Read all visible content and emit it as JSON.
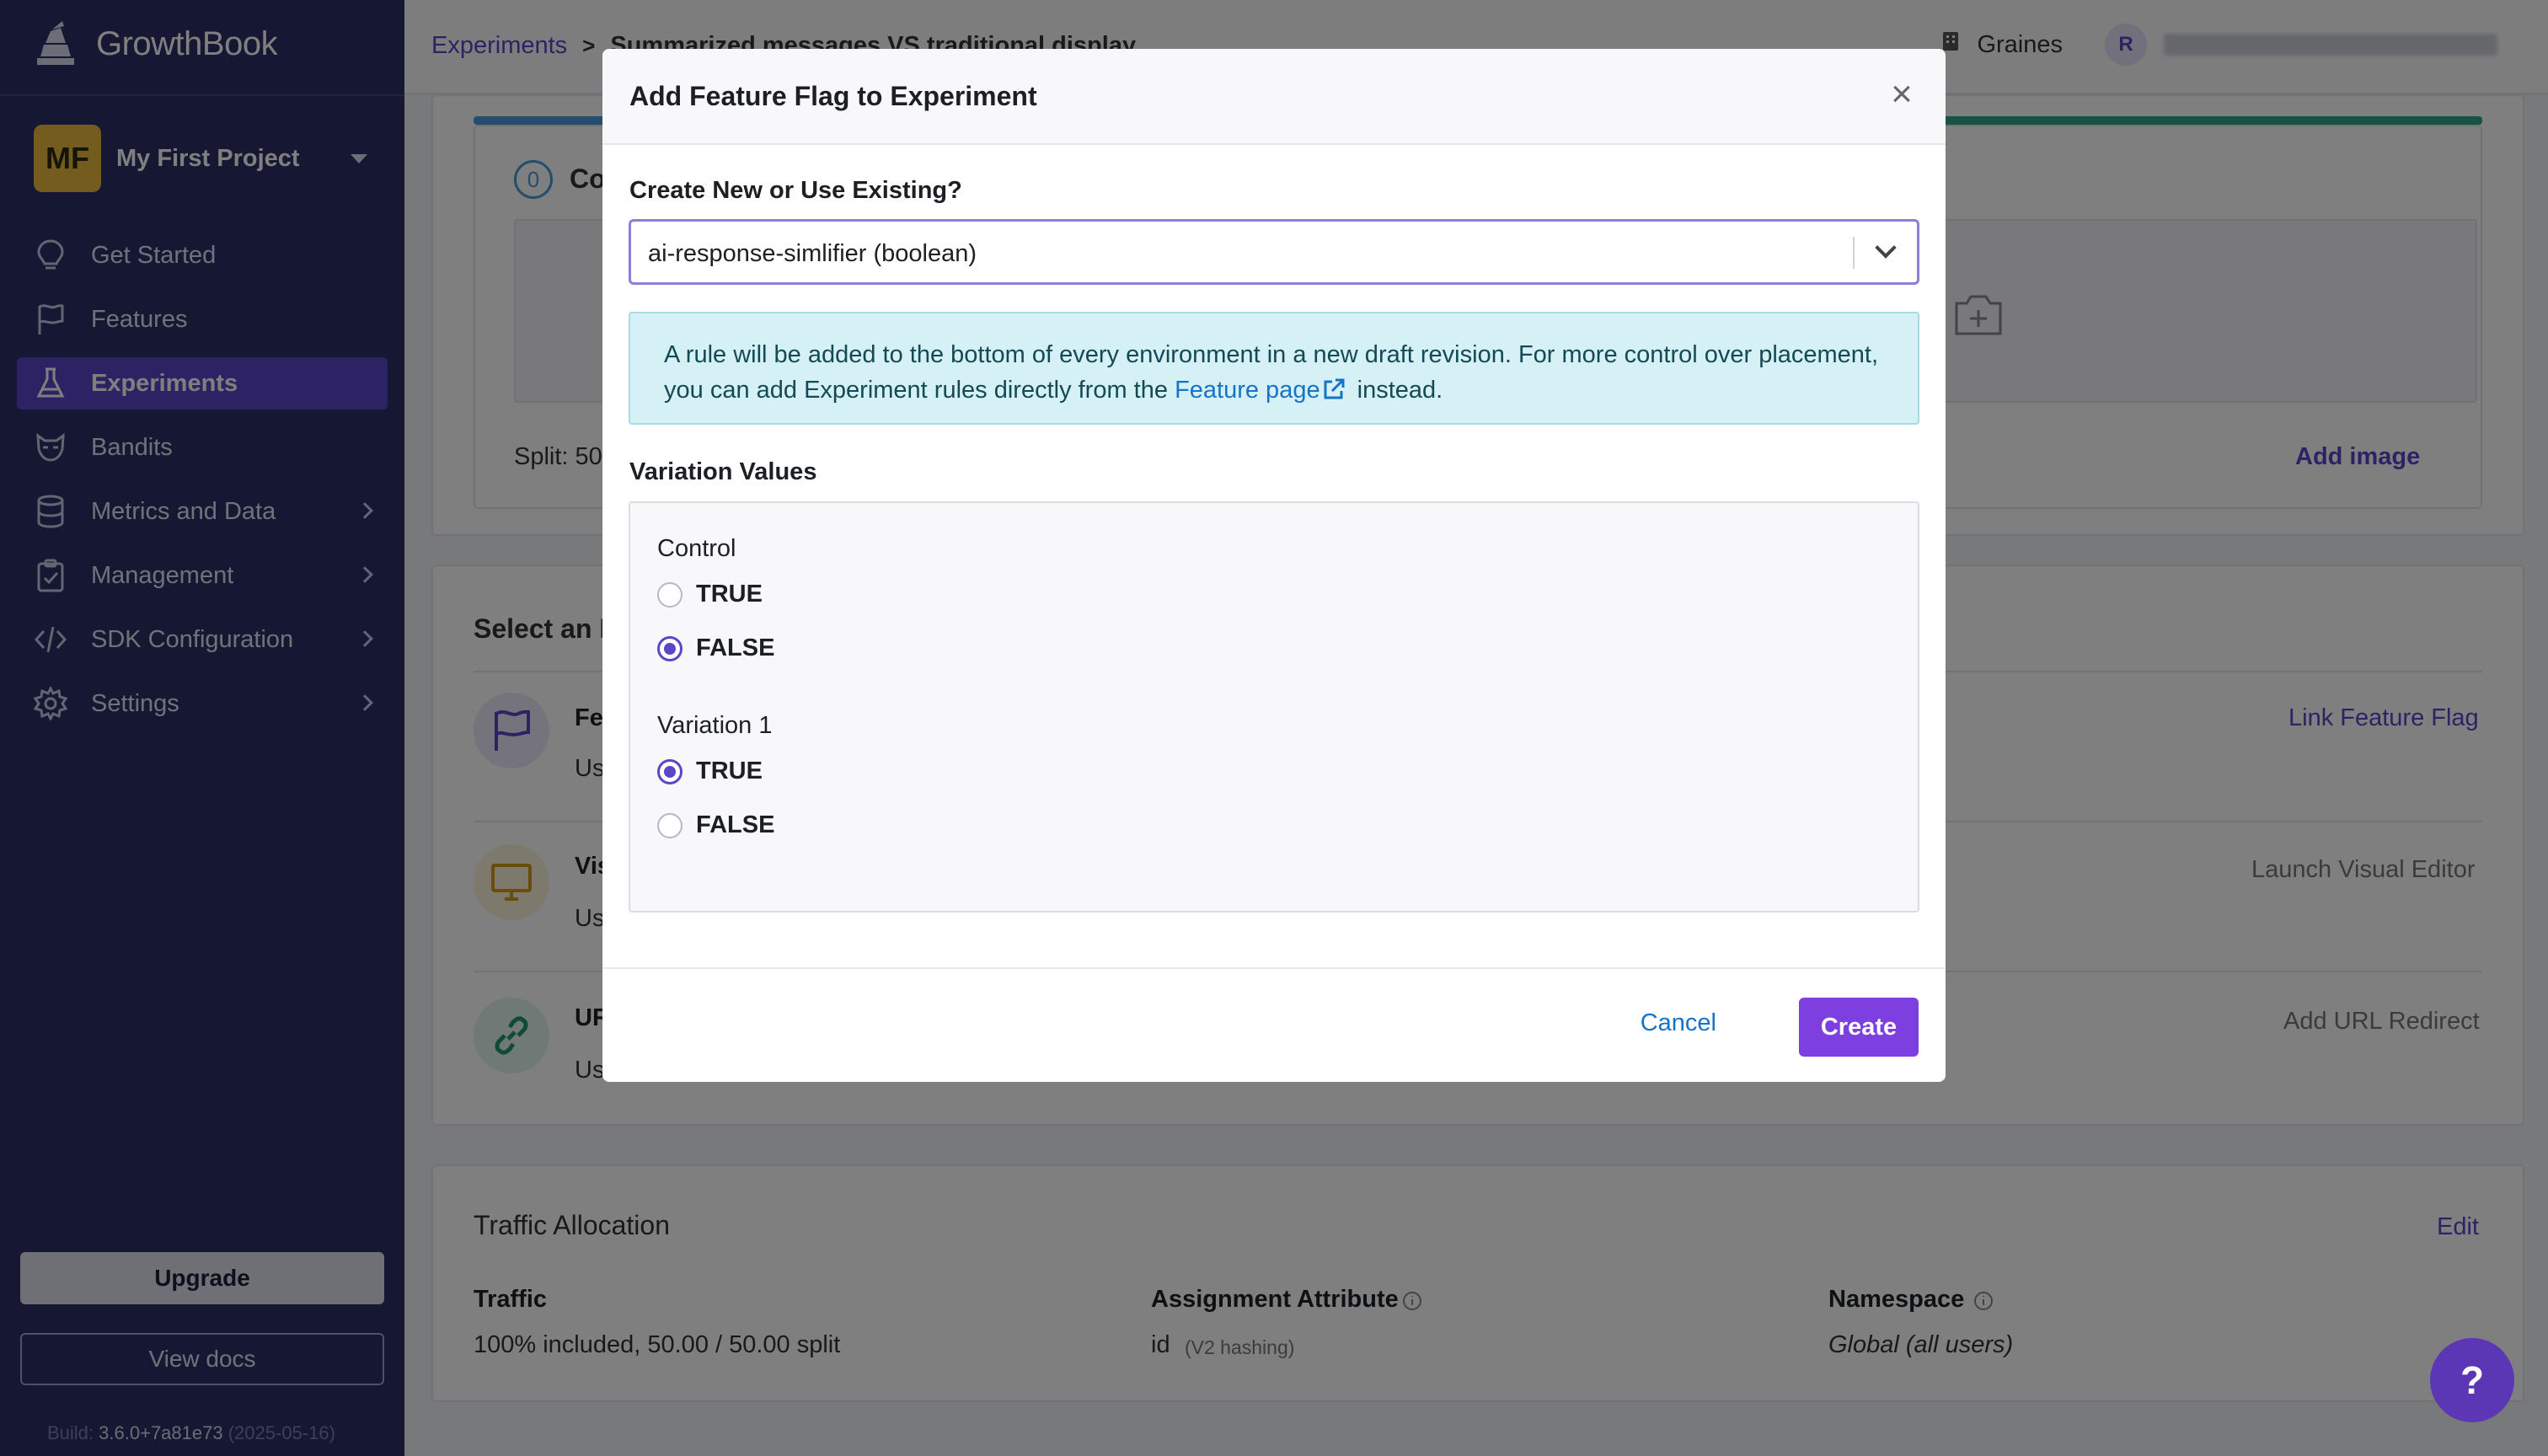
{
  "app": {
    "name": "GrowthBook"
  },
  "project": {
    "initials": "MF",
    "name": "My First Project"
  },
  "sidebar": {
    "items": [
      {
        "label": "Get Started",
        "icon": "lightbulb-icon"
      },
      {
        "label": "Features",
        "icon": "flag-icon"
      },
      {
        "label": "Experiments",
        "icon": "flask-icon",
        "active": true
      },
      {
        "label": "Bandits",
        "icon": "bandit-icon"
      },
      {
        "label": "Metrics and Data",
        "icon": "database-icon"
      },
      {
        "label": "Management",
        "icon": "clipboard-icon"
      },
      {
        "label": "SDK Configuration",
        "icon": "code-icon"
      },
      {
        "label": "Settings",
        "icon": "gear-icon"
      }
    ],
    "upgrade_label": "Upgrade",
    "docs_label": "View docs",
    "build_prefix": "Build:",
    "build_version": "3.6.0+7a81e73",
    "build_date": "(2025-05-16)"
  },
  "topbar": {
    "breadcrumb_link": "Experiments",
    "breadcrumb_sep": ">",
    "breadcrumb_current": "Summarized messages VS traditional display",
    "org_name": "Graines",
    "user_initial": "R"
  },
  "background": {
    "step_number": "0",
    "step_title_partial": "Co",
    "split_partial": "Split: 50",
    "add_image": "Add image",
    "select_title_partial": "Select an I",
    "rows": [
      {
        "title_partial": "Fe",
        "desc_partial": "Us",
        "action": "Link Feature Flag"
      },
      {
        "title_partial": "Vis",
        "desc_partial": "Us",
        "action": "Launch Visual Editor"
      },
      {
        "title_partial": "UR",
        "desc_partial": "Us",
        "action": "Add URL Redirect"
      }
    ],
    "traffic": {
      "title": "Traffic Allocation",
      "edit": "Edit",
      "traffic_label": "Traffic",
      "traffic_value": "100% included, 50.00 / 50.00 split",
      "assignment_label": "Assignment Attribute",
      "assignment_value": "id",
      "assignment_hash": "(V2 hashing)",
      "namespace_label": "Namespace",
      "namespace_value": "Global (all users)"
    }
  },
  "modal": {
    "title": "Add Feature Flag to Experiment",
    "close_label": "×",
    "field_label": "Create New or Use Existing?",
    "selected_value": "ai-response-simlifier (boolean)",
    "info_text_1": "A rule will be added to the bottom of every environment in a new draft revision. For more control over placement, you can add Experiment rules directly from the ",
    "info_link": "Feature page",
    "info_text_2": " instead.",
    "variation_values_label": "Variation Values",
    "variations": [
      {
        "name": "Control",
        "options": [
          {
            "label": "TRUE",
            "checked": false
          },
          {
            "label": "FALSE",
            "checked": true
          }
        ]
      },
      {
        "name": "Variation 1",
        "options": [
          {
            "label": "TRUE",
            "checked": true
          },
          {
            "label": "FALSE",
            "checked": false
          }
        ]
      }
    ],
    "cancel_label": "Cancel",
    "create_label": "Create"
  },
  "help": {
    "label": "?"
  },
  "colors": {
    "sidebar": "#2c3067",
    "accent": "#5b46c8",
    "primary_button": "#7d3fe0",
    "info_bg": "#d6f1f5",
    "link": "#1673c7"
  }
}
